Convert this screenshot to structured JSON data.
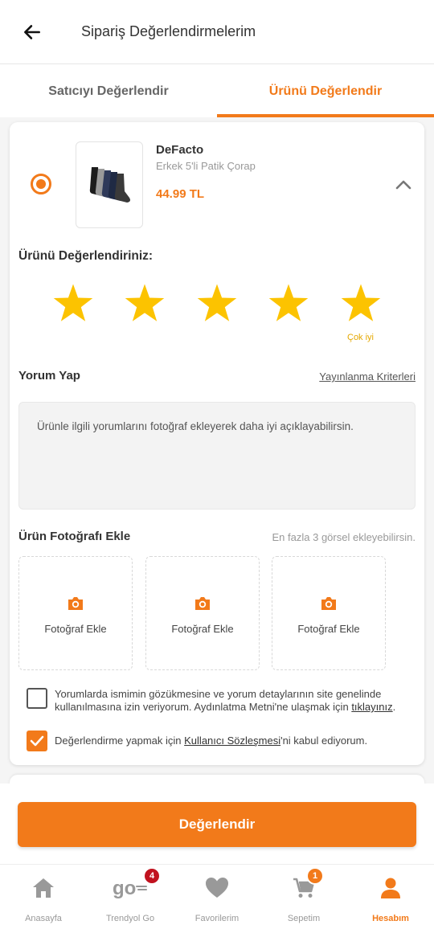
{
  "header": {
    "title": "Sipariş Değerlendirmelerim",
    "back_icon": "arrow-left-icon"
  },
  "tabs": [
    {
      "label": "Satıcıyı Değerlendir",
      "active": false
    },
    {
      "label": "Ürünü Değerlendir",
      "active": true
    }
  ],
  "product": {
    "brand": "DeFacto",
    "name": "Erkek 5'li Patik Çorap",
    "price": "44.99 TL",
    "selected": true
  },
  "rating": {
    "title": "Ürünü Değerlendiriniz:",
    "stars_total": 5,
    "stars_selected": 5,
    "selected_label": "Çok iyi",
    "star_color": "#fcc300"
  },
  "comment": {
    "title": "Yorum Yap",
    "criteria_link": "Yayınlanma Kriterleri",
    "placeholder": "Ürünle ilgili yorumlarını fotoğraf ekleyerek daha iyi açıklayabilirsin."
  },
  "photos": {
    "title": "Ürün Fotoğrafı Ekle",
    "hint": "En fazla 3 görsel ekleyebilirsin.",
    "slots": [
      {
        "label": "Fotoğraf Ekle"
      },
      {
        "label": "Fotoğraf Ekle"
      },
      {
        "label": "Fotoğraf Ekle"
      }
    ]
  },
  "consents": {
    "name_hidden": {
      "checked": false,
      "text": "Yorumlarda ismimin gözükmesine ve yorum detaylarının site genelinde kullanılmasına izin veriyorum. Aydınlatma Metni'ne ulaşmak için",
      "link": "tıklayınız",
      "suffix": "."
    },
    "terms": {
      "checked": true,
      "prefix": "Değerlendirme yapmak için",
      "link": "Kullanıcı Sözleşmesi",
      "suffix": "'ni kabul ediyorum."
    }
  },
  "submit_label": "Değerlendir",
  "nav": [
    {
      "label": "Anasayfa",
      "icon": "home-icon",
      "active": false
    },
    {
      "label": "Trendyol Go",
      "icon": "trendyol-go-icon",
      "badge": "4",
      "badge_color": "#c1121f",
      "active": false
    },
    {
      "label": "Favorilerim",
      "icon": "heart-icon",
      "active": false
    },
    {
      "label": "Sepetim",
      "icon": "cart-icon",
      "badge": "1",
      "badge_color": "#f27a1a",
      "active": false
    },
    {
      "label": "Hesabım",
      "icon": "user-icon",
      "active": true
    }
  ],
  "colors": {
    "accent": "#f27a1a",
    "star": "#fcc300"
  }
}
